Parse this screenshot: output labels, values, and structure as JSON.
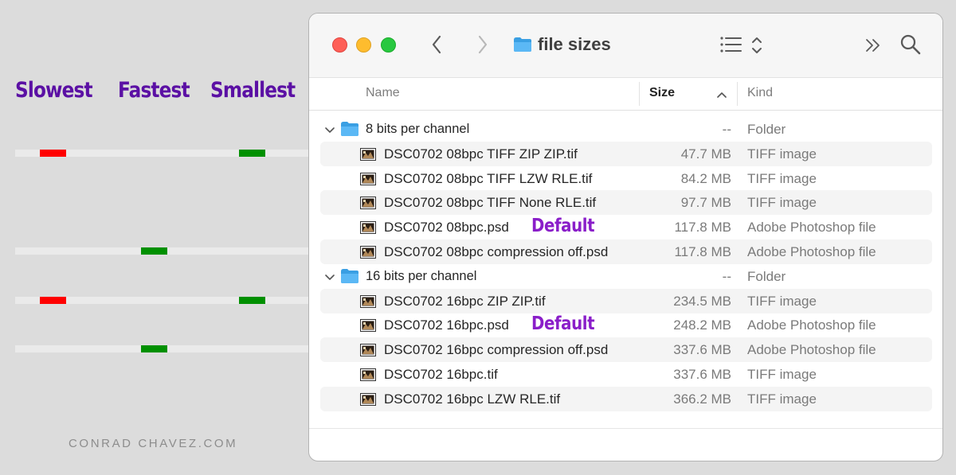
{
  "annotations": {
    "column_heads": [
      "Slowest",
      "Fastest",
      "Smallest"
    ],
    "credit": "CONRAD CHAVEZ.COM",
    "colors": {
      "slow": "#ff0000",
      "good": "#009000",
      "heading": "#5b10a4",
      "default": "#8a1ec9"
    }
  },
  "window": {
    "title": "file sizes",
    "columns": {
      "name": "Name",
      "size": "Size",
      "kind": "Kind"
    },
    "sort_indicator": "ascending"
  },
  "rows": [
    {
      "type": "folder",
      "name": "8 bits per channel",
      "size": "--",
      "kind": "Folder",
      "expanded": true
    },
    {
      "type": "file",
      "name": "DSC0702 08bpc TIFF ZIP ZIP.tif",
      "size": "47.7 MB",
      "kind": "TIFF image",
      "marks": [
        "slowest",
        "smallest"
      ]
    },
    {
      "type": "file",
      "name": "DSC0702 08bpc TIFF LZW RLE.tif",
      "size": "84.2 MB",
      "kind": "TIFF image"
    },
    {
      "type": "file",
      "name": "DSC0702 08bpc TIFF None RLE.tif",
      "size": "97.7 MB",
      "kind": "TIFF image"
    },
    {
      "type": "file",
      "name": "DSC0702 08bpc.psd",
      "size": "117.8 MB",
      "kind": "Adobe Photoshop file",
      "badge": "Default"
    },
    {
      "type": "file",
      "name": "DSC0702 08bpc compression off.psd",
      "size": "117.8 MB",
      "kind": "Adobe Photoshop file",
      "marks": [
        "fastest"
      ]
    },
    {
      "type": "folder",
      "name": "16 bits per channel",
      "size": "--",
      "kind": "Folder",
      "expanded": true
    },
    {
      "type": "file",
      "name": "DSC0702 16bpc ZIP ZIP.tif",
      "size": "234.5 MB",
      "kind": "TIFF image",
      "marks": [
        "slowest",
        "smallest"
      ]
    },
    {
      "type": "file",
      "name": "DSC0702 16bpc.psd",
      "size": "248.2 MB",
      "kind": "Adobe Photoshop file",
      "badge": "Default"
    },
    {
      "type": "file",
      "name": "DSC0702 16bpc compression off.psd",
      "size": "337.6 MB",
      "kind": "Adobe Photoshop file",
      "marks": [
        "fastest"
      ]
    },
    {
      "type": "file",
      "name": "DSC0702 16bpc.tif",
      "size": "337.6 MB",
      "kind": "TIFF image"
    },
    {
      "type": "file",
      "name": "DSC0702 16bpc LZW RLE.tif",
      "size": "366.2 MB",
      "kind": "TIFF image"
    }
  ]
}
